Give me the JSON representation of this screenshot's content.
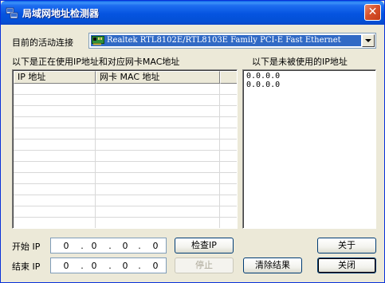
{
  "window": {
    "title": "局域网地址检测器",
    "close_glyph": "✕"
  },
  "connection": {
    "label": "目前的活动连接",
    "selected": "Realtek RTL8102E/RTL8103E Family PCI-E Fast Ethernet"
  },
  "used": {
    "label": "以下是正在使用IP地址和对应网卡MAC地址",
    "columns": [
      "IP 地址",
      "网卡 MAC 地址"
    ]
  },
  "unused": {
    "label": "以下是未被使用的IP地址",
    "items": [
      "0.0.0.0",
      "0.0.0.0"
    ]
  },
  "start_ip": {
    "label": "开始 IP",
    "octets": [
      "0",
      "0",
      "0",
      "0"
    ]
  },
  "end_ip": {
    "label": "结束 IP",
    "octets": [
      "0",
      "0",
      "0",
      "0"
    ]
  },
  "buttons": {
    "check": "检查IP",
    "stop": "停止",
    "clear": "清除结果",
    "about": "关于",
    "close": "关闭"
  },
  "colors": {
    "titlebar": "#0554e0",
    "selection": "#316ac5",
    "face": "#ece9d8"
  }
}
